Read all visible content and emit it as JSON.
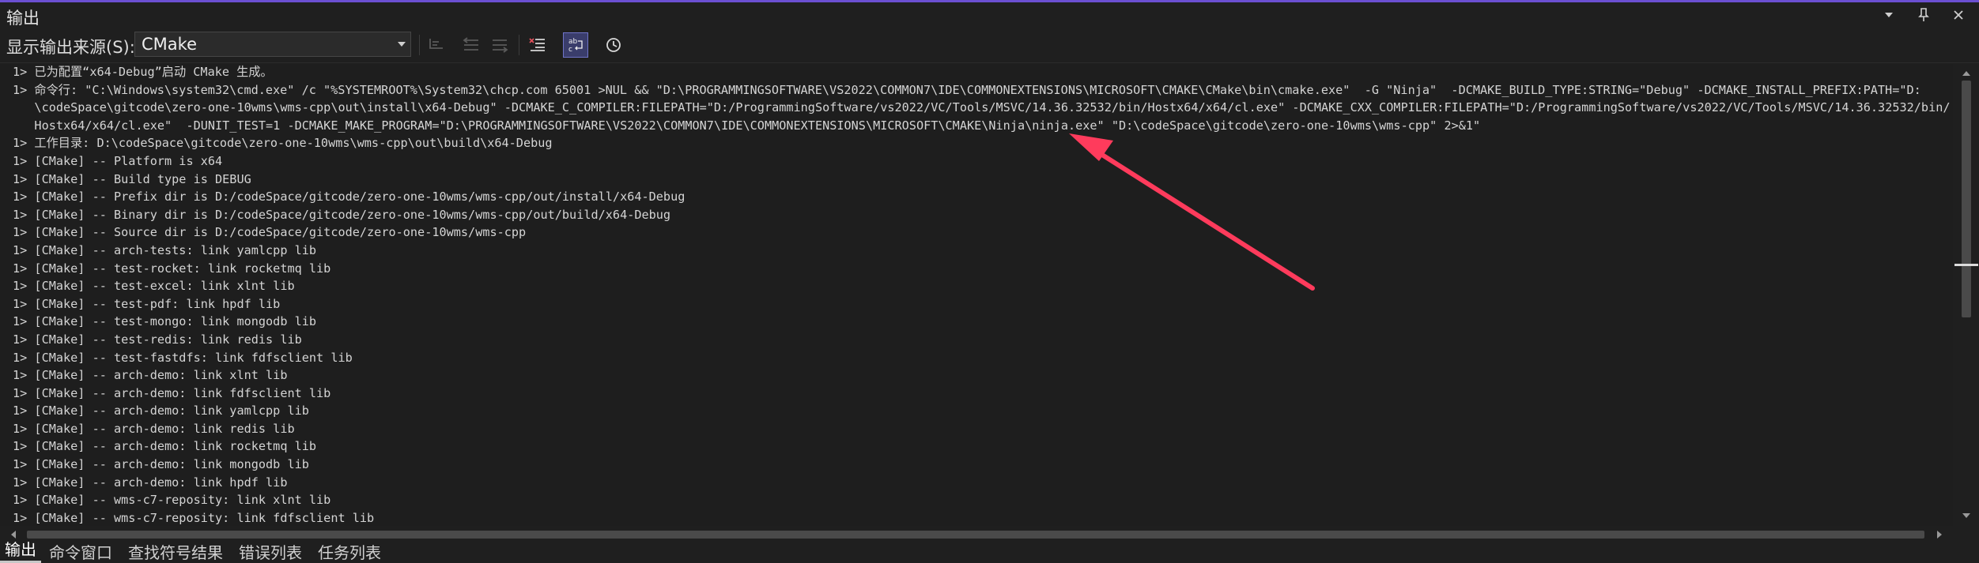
{
  "window": {
    "title": "输出"
  },
  "toolbar": {
    "source_label": "显示输出来源(S):",
    "source_value": "CMake"
  },
  "output_lines": [
    "1> 已为配置“x64-Debug”启动 CMake 生成。",
    "1> 命令行: \"C:\\Windows\\system32\\cmd.exe\" /c \"%SYSTEMROOT%\\System32\\chcp.com 65001 >NUL && \"D:\\PROGRAMMINGSOFTWARE\\VS2022\\COMMON7\\IDE\\COMMONEXTENSIONS\\MICROSOFT\\CMAKE\\CMake\\bin\\cmake.exe\"  -G \"Ninja\"  -DCMAKE_BUILD_TYPE:STRING=\"Debug\" -DCMAKE_INSTALL_PREFIX:PATH=\"D:",
    "   \\codeSpace\\gitcode\\zero-one-10wms\\wms-cpp\\out\\install\\x64-Debug\" -DCMAKE_C_COMPILER:FILEPATH=\"D:/ProgrammingSoftware/vs2022/VC/Tools/MSVC/14.36.32532/bin/Hostx64/x64/cl.exe\" -DCMAKE_CXX_COMPILER:FILEPATH=\"D:/ProgrammingSoftware/vs2022/VC/Tools/MSVC/14.36.32532/bin/",
    "   Hostx64/x64/cl.exe\"  -DUNIT_TEST=1 -DCMAKE_MAKE_PROGRAM=\"D:\\PROGRAMMINGSOFTWARE\\VS2022\\COMMON7\\IDE\\COMMONEXTENSIONS\\MICROSOFT\\CMAKE\\Ninja\\ninja.exe\" \"D:\\codeSpace\\gitcode\\zero-one-10wms\\wms-cpp\" 2>&1\"",
    "1> 工作目录: D:\\codeSpace\\gitcode\\zero-one-10wms\\wms-cpp\\out\\build\\x64-Debug",
    "1> [CMake] -- Platform is x64",
    "1> [CMake] -- Build type is DEBUG",
    "1> [CMake] -- Prefix dir is D:/codeSpace/gitcode/zero-one-10wms/wms-cpp/out/install/x64-Debug",
    "1> [CMake] -- Binary dir is D:/codeSpace/gitcode/zero-one-10wms/wms-cpp/out/build/x64-Debug",
    "1> [CMake] -- Source dir is D:/codeSpace/gitcode/zero-one-10wms/wms-cpp",
    "1> [CMake] -- arch-tests: link yamlcpp lib",
    "1> [CMake] -- test-rocket: link rocketmq lib",
    "1> [CMake] -- test-excel: link xlnt lib",
    "1> [CMake] -- test-pdf: link hpdf lib",
    "1> [CMake] -- test-mongo: link mongodb lib",
    "1> [CMake] -- test-redis: link redis lib",
    "1> [CMake] -- test-fastdfs: link fdfsclient lib",
    "1> [CMake] -- arch-demo: link xlnt lib",
    "1> [CMake] -- arch-demo: link fdfsclient lib",
    "1> [CMake] -- arch-demo: link yamlcpp lib",
    "1> [CMake] -- arch-demo: link redis lib",
    "1> [CMake] -- arch-demo: link rocketmq lib",
    "1> [CMake] -- arch-demo: link mongodb lib",
    "1> [CMake] -- arch-demo: link hpdf lib",
    "1> [CMake] -- wms-c7-reposity: link xlnt lib",
    "1> [CMake] -- wms-c7-reposity: link fdfsclient lib"
  ],
  "tabs": [
    {
      "label": "输出",
      "active": true
    },
    {
      "label": "命令窗口",
      "active": false
    },
    {
      "label": "查找符号结果",
      "active": false
    },
    {
      "label": "错误列表",
      "active": false
    },
    {
      "label": "任务列表",
      "active": false
    }
  ],
  "colors": {
    "accent": "#6b4fd1",
    "arrow": "#ff3b5c",
    "background": "#1e1e1e"
  },
  "icons": [
    "dropdown-icon",
    "pin-icon",
    "close-icon",
    "find-message-icon",
    "prev-message-icon",
    "next-message-icon",
    "clear-all-icon",
    "word-wrap-icon",
    "timestamp-icon"
  ]
}
